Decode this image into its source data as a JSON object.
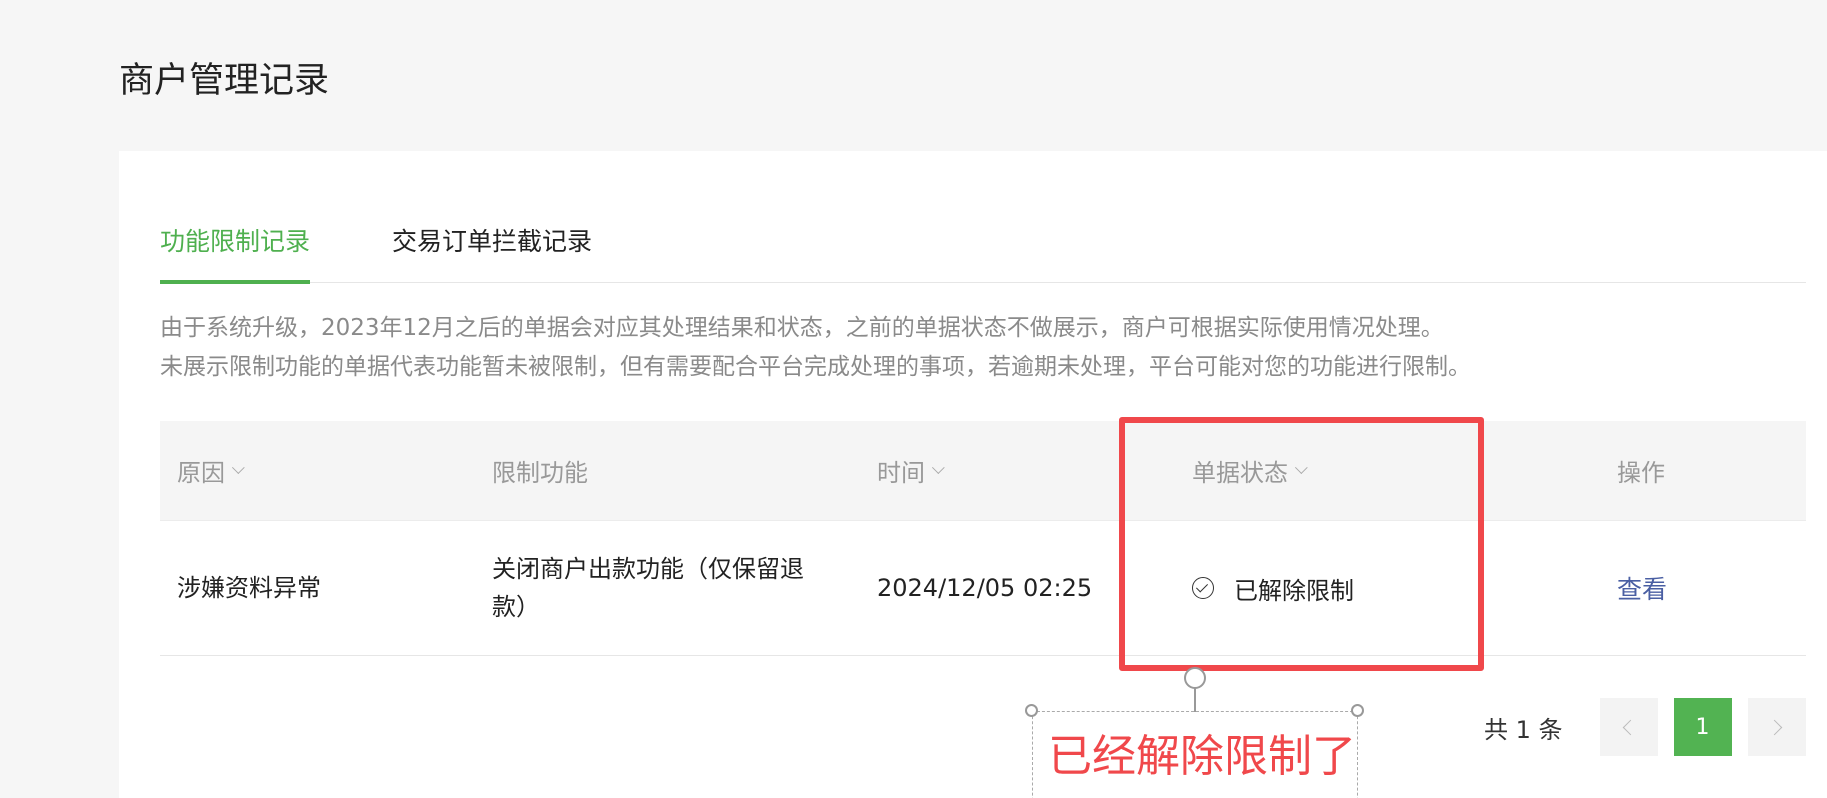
{
  "page_title": "商户管理记录",
  "tabs": [
    {
      "label": "功能限制记录",
      "active": true
    },
    {
      "label": "交易订单拦截记录",
      "active": false
    }
  ],
  "notice": {
    "line1": "由于系统升级，2023年12月之后的单据会对应其处理结果和状态，之前的单据状态不做展示，商户可根据实际使用情况处理。",
    "line2": "未展示限制功能的单据代表功能暂未被限制，但有需要配合平台完成处理的事项，若逾期未处理，平台可能对您的功能进行限制。"
  },
  "table": {
    "headers": {
      "reason": "原因",
      "function": "限制功能",
      "time": "时间",
      "status": "单据状态",
      "action": "操作"
    },
    "rows": [
      {
        "reason": "涉嫌资料异常",
        "function": "关闭商户出款功能（仅保留退款）",
        "time": "2024/12/05 02:25",
        "status": "已解除限制",
        "action": "查看"
      }
    ]
  },
  "pagination": {
    "total_text": "共 1 条",
    "current_page": "1"
  },
  "annotation": {
    "text": "已经解除限制了",
    "color": "#f0484b"
  },
  "colors": {
    "accent": "#4fb04f",
    "link": "#4a5fa3",
    "annotation": "#f0484b"
  }
}
